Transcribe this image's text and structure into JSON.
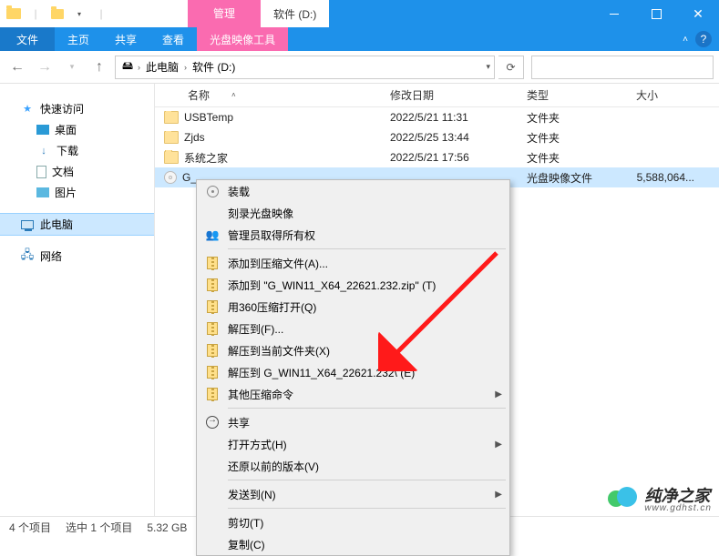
{
  "titlebar": {
    "manage_tab": "管理",
    "drive_tab": "软件 (D:)"
  },
  "ribbon": {
    "file": "文件",
    "home": "主页",
    "share": "共享",
    "view": "查看",
    "disc_tools": "光盘映像工具"
  },
  "breadcrumb": {
    "root": "此电脑",
    "drive": "软件 (D:)"
  },
  "sidebar": {
    "quick_access": "快速访问",
    "desktop": "桌面",
    "downloads": "下载",
    "documents": "文档",
    "pictures": "图片",
    "this_pc": "此电脑",
    "network": "网络"
  },
  "columns": {
    "name": "名称",
    "date": "修改日期",
    "type": "类型",
    "size": "大小"
  },
  "rows": [
    {
      "name": "USBTemp",
      "date": "2022/5/21 11:31",
      "type": "文件夹",
      "size": "",
      "icon": "folder"
    },
    {
      "name": "Zjds",
      "date": "2022/5/25 13:44",
      "type": "文件夹",
      "size": "",
      "icon": "folder"
    },
    {
      "name": "系统之家",
      "date": "2022/5/21 17:56",
      "type": "文件夹",
      "size": "",
      "icon": "folder"
    },
    {
      "name": "G_",
      "date": "",
      "type": "光盘映像文件",
      "size": "5,588,064...",
      "icon": "iso",
      "selected": true
    }
  ],
  "context_menu": {
    "mount": "装载",
    "burn": "刻录光盘映像",
    "admin": "管理员取得所有权",
    "add_archive": "添加到压缩文件(A)...",
    "add_zip": "添加到 \"G_WIN11_X64_22621.232.zip\" (T)",
    "open_360": "用360压缩打开(Q)",
    "extract_to": "解压到(F)...",
    "extract_here": "解压到当前文件夹(X)",
    "extract_named": "解压到 G_WIN11_X64_22621.232\\ (E)",
    "other_compress": "其他压缩命令",
    "share": "共享",
    "open_with": "打开方式(H)",
    "restore": "还原以前的版本(V)",
    "send_to": "发送到(N)",
    "cut": "剪切(T)",
    "copy": "复制(C)"
  },
  "statusbar": {
    "items": "4 个项目",
    "selected": "选中 1 个项目",
    "size": "5.32 GB"
  },
  "watermark": {
    "cn": "纯净之家",
    "en": "www.gdhst.cn"
  }
}
